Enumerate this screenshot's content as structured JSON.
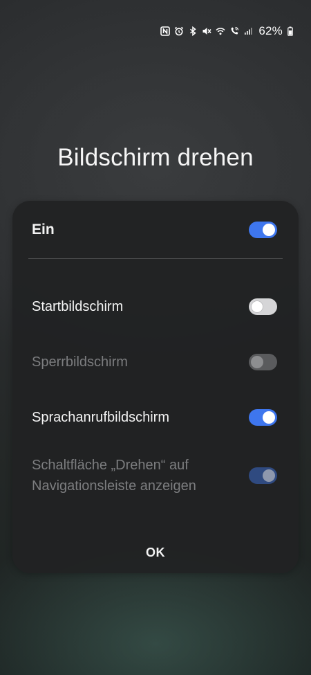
{
  "status_bar": {
    "icons": [
      "nfc-icon",
      "alarm-icon",
      "bluetooth-icon",
      "mute-icon",
      "wifi-icon",
      "wifi-calling-icon",
      "signal-icon",
      "battery-icon"
    ],
    "battery_percent": "62%"
  },
  "dialog": {
    "title": "Bildschirm drehen",
    "main_toggle": {
      "label": "Ein",
      "state": "on"
    },
    "options": [
      {
        "label": "Startbildschirm",
        "state": "off",
        "enabled": true
      },
      {
        "label": "Sperrbildschirm",
        "state": "off",
        "enabled": false
      },
      {
        "label": "Sprachanrufbildschirm",
        "state": "on",
        "enabled": true
      },
      {
        "label": "Schaltfläche „Drehen“ auf Navigationsleiste anzeigen",
        "state": "on",
        "enabled": false
      }
    ],
    "ok_label": "OK"
  },
  "colors": {
    "toggle_on": "#3e76ee",
    "toggle_off": "#d5d5d7",
    "card_background": "#212223",
    "disabled_text": "#7c7d7f"
  }
}
